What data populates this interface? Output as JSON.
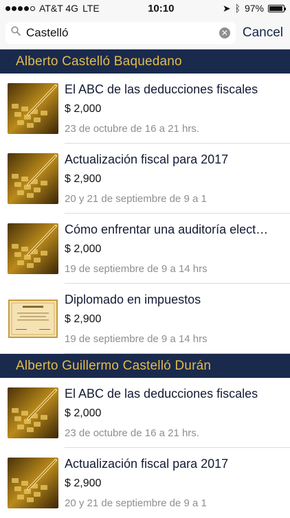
{
  "status_bar": {
    "carrier": "AT&T 4G",
    "network": "LTE",
    "time": "10:10",
    "battery": "97%",
    "battery_level": 0.97
  },
  "search": {
    "value": "Castelló",
    "cancel_label": "Cancel"
  },
  "sections": [
    {
      "header": "Alberto Castelló Baquedano",
      "items": [
        {
          "title": "El ABC de las deducciones fiscales",
          "price": "$ 2,000",
          "date": "23 de octubre de 16 a 21 hrs.",
          "thumb": "calculator"
        },
        {
          "title": "Actualización fiscal para 2017",
          "price": "$ 2,900",
          "date": "20 y 21 de septiembre de 9 a 1",
          "thumb": "calculator"
        },
        {
          "title": "Cómo enfrentar una auditoría elect…",
          "price": "$ 2,000",
          "date": "19 de septiembre de 9 a 14 hrs",
          "thumb": "calculator"
        },
        {
          "title": "Diplomado en impuestos",
          "price": "$ 2,900",
          "date": "19 de septiembre de 9 a 14 hrs",
          "thumb": "diploma"
        }
      ]
    },
    {
      "header": "Alberto Guillermo Castelló Durán",
      "items": [
        {
          "title": "El ABC de las deducciones fiscales",
          "price": "$ 2,000",
          "date": "23 de octubre de 16 a 21 hrs.",
          "thumb": "calculator"
        },
        {
          "title": "Actualización fiscal para 2017",
          "price": "$ 2,900",
          "date": "20 y 21 de septiembre de 9 a 1",
          "thumb": "calculator"
        }
      ]
    }
  ],
  "colors": {
    "header_bg": "#192a4d",
    "header_text": "#e3bb48",
    "accent": "#142548"
  }
}
